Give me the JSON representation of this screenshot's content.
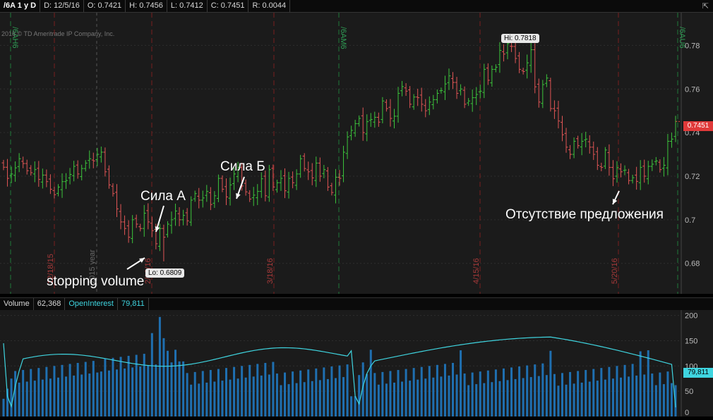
{
  "header": {
    "symbol": "/6A 1 y D",
    "date": "D: 12/5/16",
    "open": "O: 0.7421",
    "high": "H: 0.7456",
    "low": "L: 0.7412",
    "close": "C: 0.7451",
    "range": "R: 0.0044",
    "expand_icon": "collapse-icon"
  },
  "copyright": "2016 © TD Ameritrade IP Company, Inc.",
  "price_axis": {
    "ticks": [
      "0.78",
      "0.76",
      "0.74",
      "0.72",
      "0.7",
      "0.68"
    ],
    "tick_values": [
      0.78,
      0.76,
      0.74,
      0.72,
      0.7,
      0.68
    ],
    "ymin": 0.666,
    "ymax": 0.795,
    "last_price": "0.7451",
    "last_price_color": "#e03a3a"
  },
  "vertical_labels": {
    "green": [
      "/6AH6",
      "/6AM6",
      "/6AU6"
    ],
    "red": [
      "12/18/15",
      "2/19/16",
      "3/18/16",
      "4/15/16",
      "5/20/16"
    ],
    "year": "2015 year"
  },
  "markers": {
    "hi": "Hi: 0.7818",
    "lo": "Lo: 0.6809"
  },
  "annotations": {
    "sila_a": "Сила А",
    "sila_b": "Сила Б",
    "stopping": "stopping volume",
    "otsutstvie": "Отсутствие предложения"
  },
  "volume_header": {
    "volume_label": "Volume",
    "volume_value": "62,368",
    "oi_label": "OpenInterest",
    "oi_value": "79,811"
  },
  "volume_axis": {
    "ticks": [
      "200",
      "150",
      "100",
      "50",
      "0"
    ],
    "tick_values": [
      200,
      150,
      100,
      50,
      0
    ],
    "ymax": 205,
    "oi_last": "79,811",
    "oi_color": "#3fd5e0"
  },
  "colors": {
    "up": "#3cc43c",
    "down": "#e05555",
    "volume": "#1f6fb0",
    "oi": "#3fd5e0",
    "bg": "#1b1b1b"
  },
  "chart_data": {
    "type": "bar",
    "ohlc_close": [
      0.7241,
      0.719,
      0.721,
      0.7238,
      0.728,
      0.7258,
      0.7225,
      0.7216,
      0.723,
      0.7185,
      0.7205,
      0.7175,
      0.714,
      0.7115,
      0.715,
      0.7175,
      0.718,
      0.7208,
      0.7245,
      0.721,
      0.7235,
      0.726,
      0.728,
      0.727,
      0.73,
      0.731,
      0.722,
      0.716,
      0.712,
      0.705,
      0.699,
      0.696,
      0.692,
      0.7,
      0.698,
      0.696,
      0.703,
      0.699,
      0.695,
      0.689,
      0.696,
      0.692,
      0.698,
      0.7,
      0.704,
      0.7,
      0.702,
      0.6995,
      0.709,
      0.712,
      0.709,
      0.71,
      0.713,
      0.707,
      0.711,
      0.719,
      0.714,
      0.7105,
      0.716,
      0.721,
      0.724,
      0.7155,
      0.7128,
      0.7095,
      0.7113,
      0.713,
      0.7188,
      0.711,
      0.723,
      0.715,
      0.717,
      0.719,
      0.7133,
      0.719,
      0.717,
      0.721,
      0.728,
      0.7235,
      0.722,
      0.7192,
      0.726,
      0.72,
      0.723,
      0.715,
      0.7125,
      0.7195,
      0.719,
      0.731,
      0.738,
      0.741,
      0.7441,
      0.7465,
      0.74,
      0.745,
      0.746,
      0.747,
      0.7448,
      0.7545,
      0.751,
      0.7465,
      0.7475,
      0.758,
      0.7611,
      0.759,
      0.753,
      0.7563,
      0.756,
      0.753,
      0.75,
      0.754,
      0.7551,
      0.758,
      0.7593,
      0.7623,
      0.766,
      0.763,
      0.758,
      0.76,
      0.753,
      0.7545,
      0.756,
      0.7575,
      0.759,
      0.769,
      0.764,
      0.769,
      0.77,
      0.7777,
      0.776,
      0.7808,
      0.7795,
      0.774,
      0.769,
      0.768,
      0.772,
      0.778,
      0.761,
      0.754,
      0.762,
      0.765,
      0.751,
      0.75,
      0.7453,
      0.739,
      0.7333,
      0.73,
      0.736,
      0.734,
      0.736,
      0.737,
      0.7333,
      0.73,
      0.725,
      0.724,
      0.732,
      0.724,
      0.7188,
      0.7239,
      0.722,
      0.7228,
      0.718,
      0.7193,
      0.7176,
      0.724,
      0.72,
      0.7245,
      0.7255,
      0.727,
      0.723,
      0.725,
      0.736,
      0.737,
      0.7451
    ],
    "x_labels": [
      "12/18/15",
      "2/19/16",
      "3/18/16",
      "4/15/16",
      "5/20/16"
    ],
    "contracts": [
      "/6AH6",
      "/6AM6",
      "/6AU6"
    ],
    "y_ticks": [
      0.68,
      0.7,
      0.72,
      0.74,
      0.76,
      0.78
    ],
    "hi": 0.7818,
    "lo": 0.6809,
    "last": 0.7451,
    "volume_ticks": [
      0,
      50,
      100,
      150,
      200
    ]
  }
}
